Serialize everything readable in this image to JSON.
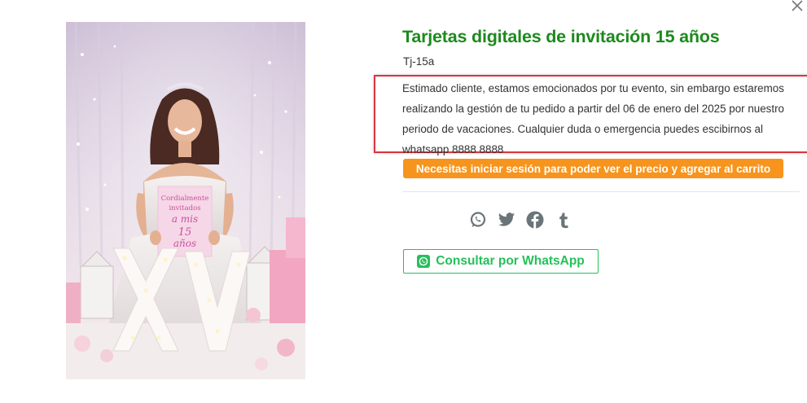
{
  "product": {
    "title": "Tarjetas digitales de invitación 15 años",
    "sku": "Tj-15a",
    "notice": "Estimado cliente, estamos emocionados por tu evento, sin embargo estaremos realizando la gestión de tu pedido a partir del 06 de enero del 2025 por nuestro periodo de vacaciones. Cualquier duda o emergencia puedes escibirnos al whatsapp 8888 8888",
    "login_button_label": "Necesitas iniciar sesión para poder ver el precio y agregar al carrito",
    "whatsapp_button_label": "Consultar por WhatsApp"
  },
  "image": {
    "card_line1": "Cordialmente",
    "card_line2": "invitados",
    "card_line3": "a mis",
    "card_line4": "15",
    "card_line5": "años"
  },
  "share_icons": [
    "whatsapp-icon",
    "twitter-icon",
    "facebook-icon",
    "tumblr-icon"
  ],
  "colors": {
    "title": "#1c8a1c",
    "notice_border": "#d9363e",
    "login_button": "#f7941d",
    "whatsapp": "#25c05a",
    "share_icons": "#6b7478"
  }
}
